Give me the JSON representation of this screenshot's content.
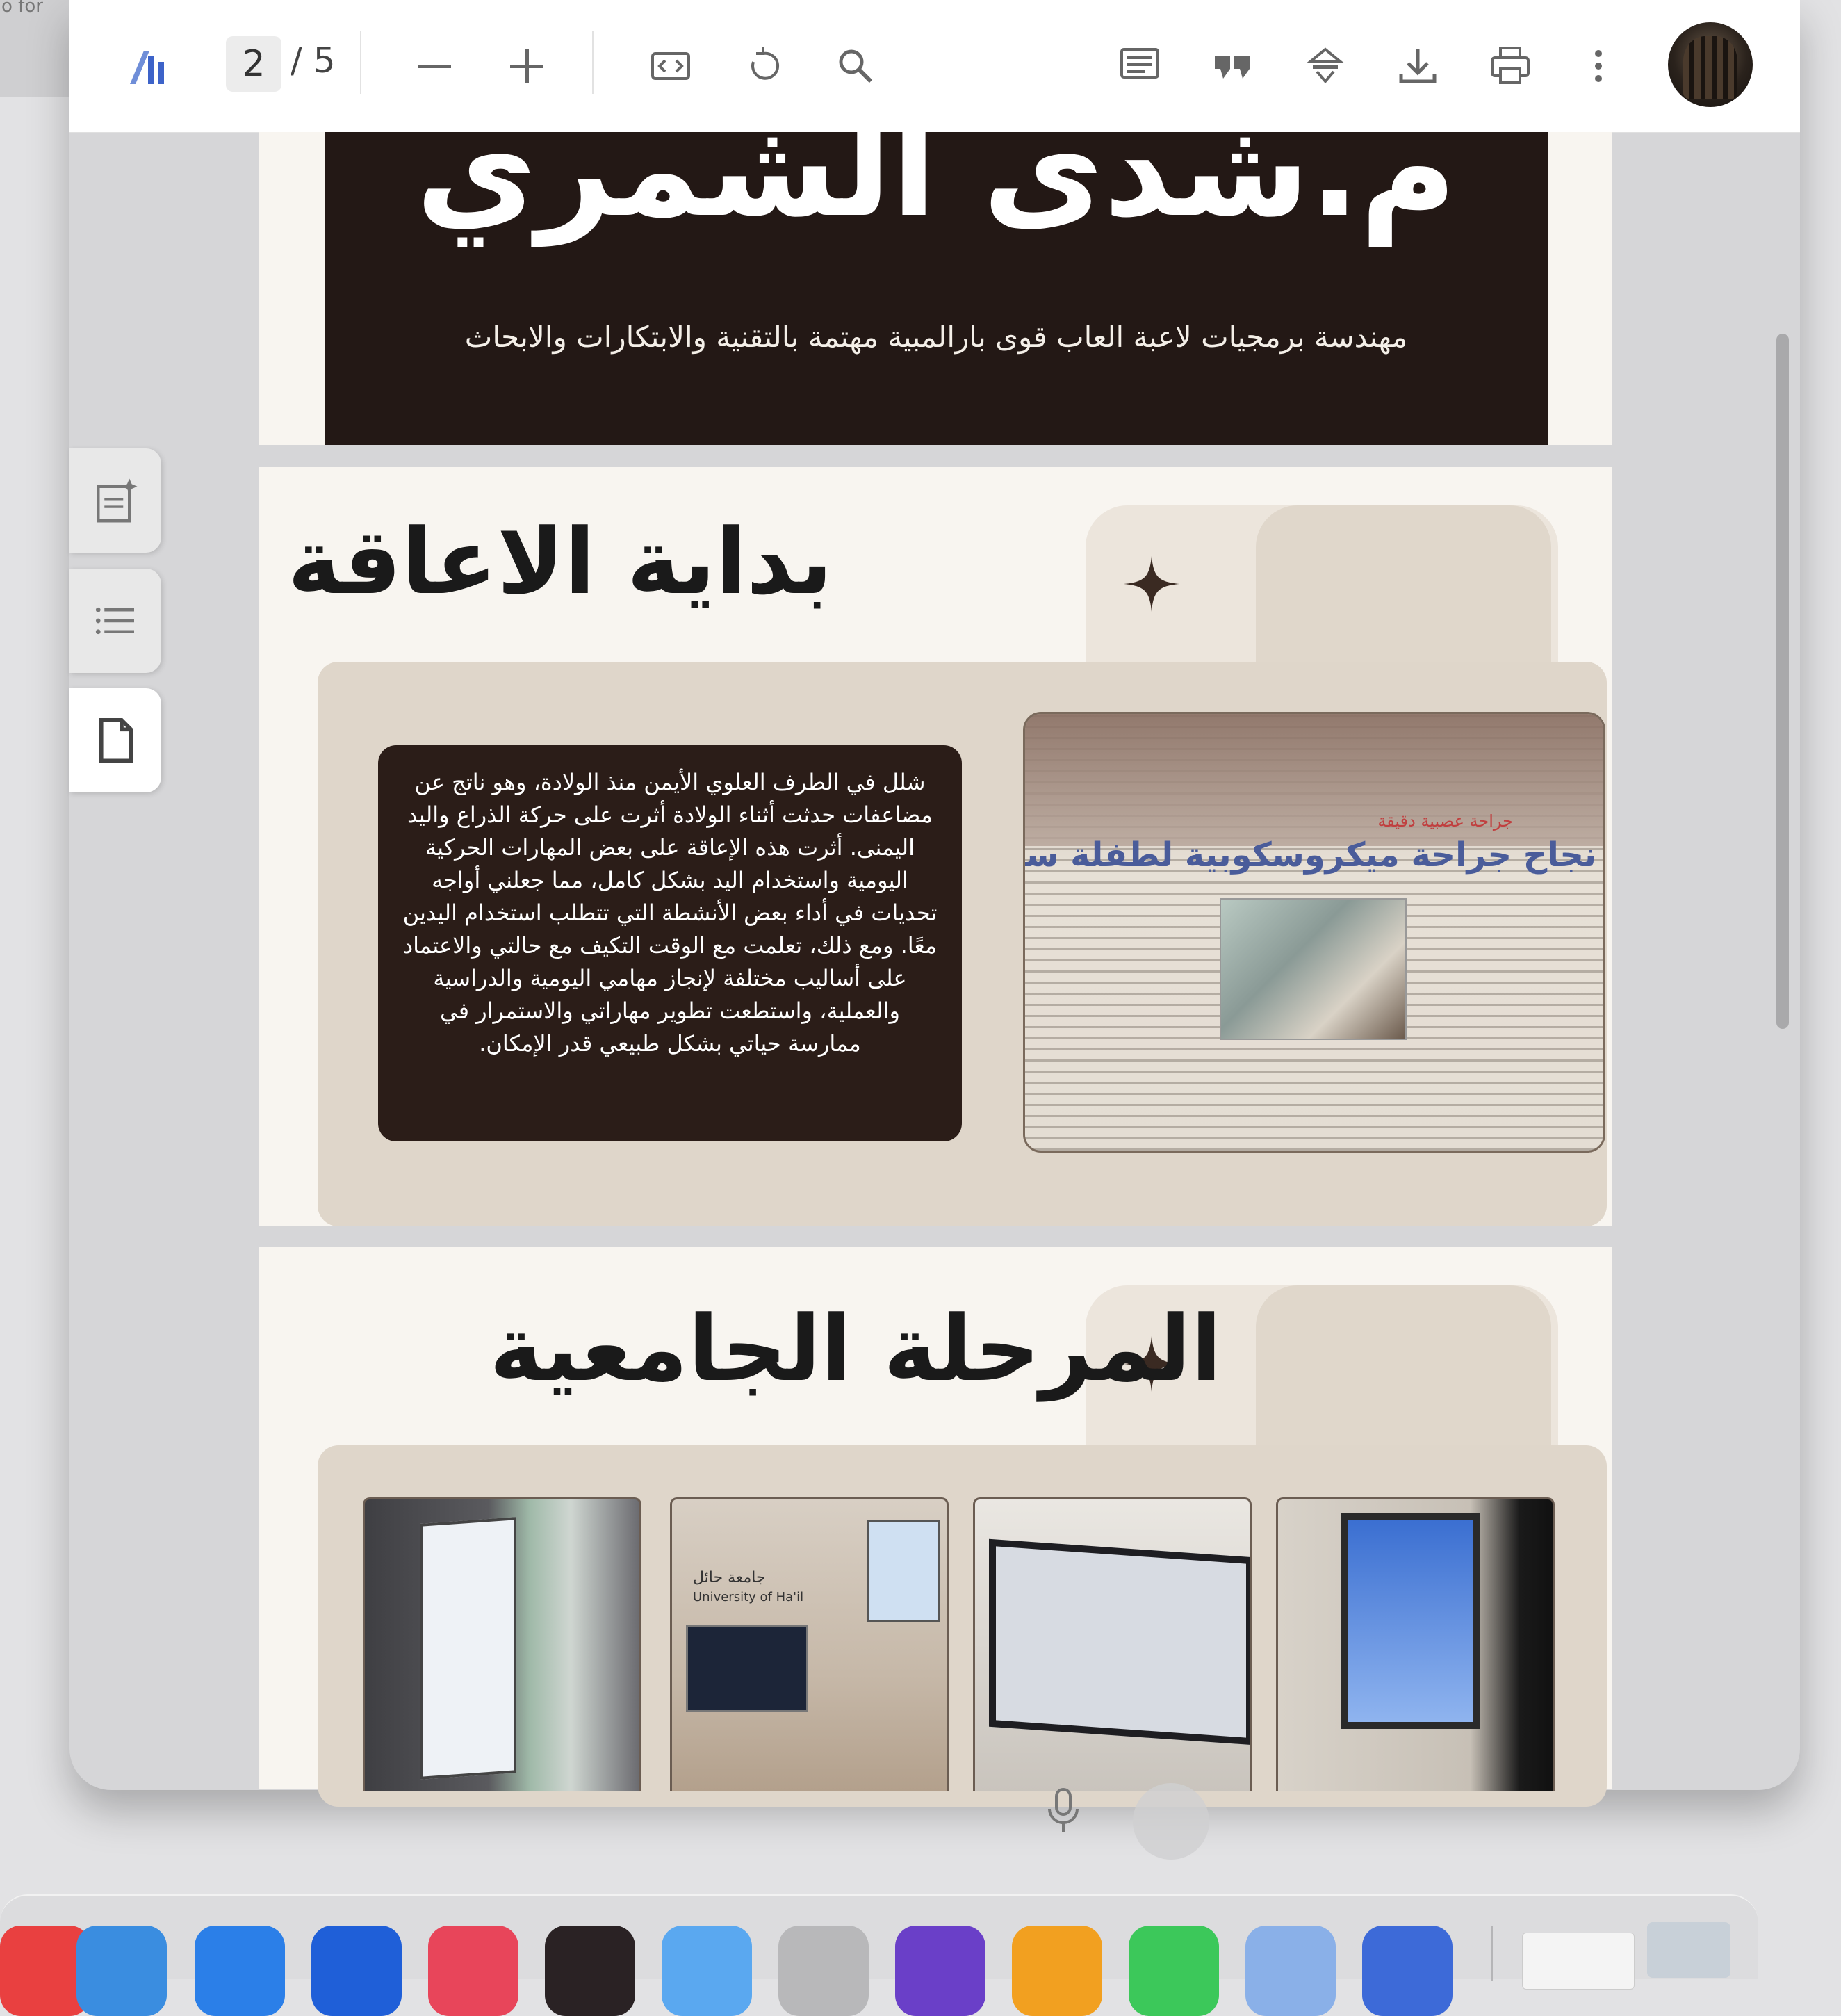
{
  "left_edge": {
    "text": "o for"
  },
  "toolbar": {
    "page_current": "2",
    "page_total": "/ 5",
    "icons": [
      "app-logo-icon",
      "zoom-out-icon",
      "zoom-in-icon",
      "fit-page-icon",
      "rotate-icon",
      "search-icon",
      "comment-icon",
      "quote-icon",
      "annotate-icon",
      "download-icon",
      "print-icon",
      "more-icon"
    ],
    "avatar": "user-avatar"
  },
  "side_panel": {
    "buttons": [
      "add-note-icon",
      "outline-list-icon",
      "page-thumbnail-icon"
    ],
    "active_index": 2
  },
  "slides": {
    "slide1": {
      "name": "م.شدى الشمري",
      "subtitle": "مهندسة برمجيات لاعبة العاب قوى بارالمبية مهتمة بالتقنية والابتكارات والابحاث"
    },
    "slide2": {
      "title": "بداية الاعاقة",
      "body": "شلل في الطرف العلوي الأيمن منذ الولادة، وهو ناتج عن مضاعفات حدثت أثناء الولادة أثرت على حركة الذراع واليد اليمنى. أثرت هذه الإعاقة على بعض المهارات الحركية اليومية واستخدام اليد بشكل كامل، مما جعلني أواجه تحديات في أداء بعض الأنشطة التي تتطلب استخدام اليدين معًا. ومع ذلك، تعلمت مع الوقت التكيف مع حالتي والاعتماد على أساليب مختلفة لإنجاز مهامي اليومية والدراسية والعملية، واستطعت تطوير مهاراتي والاستمرار في ممارسة حياتي بشكل طبيعي قدر الإمكان.",
      "newspaper_headline": "نجاح جراحة ميكروسكوبية لطفلة سعودية",
      "newspaper_subhead": "جراحة عصبية دقيقة"
    },
    "slide3": {
      "title": "المرحلة الجامعية",
      "thumb2_caption_ar": "جامعة حائل",
      "thumb2_caption_en": "University of Ha'il"
    }
  },
  "colors": {
    "dark_panel": "#231815",
    "slide_bg": "#f8f5f0",
    "beige_panel": "#dfd6ca",
    "toolbar_bg": "#ffffff"
  }
}
